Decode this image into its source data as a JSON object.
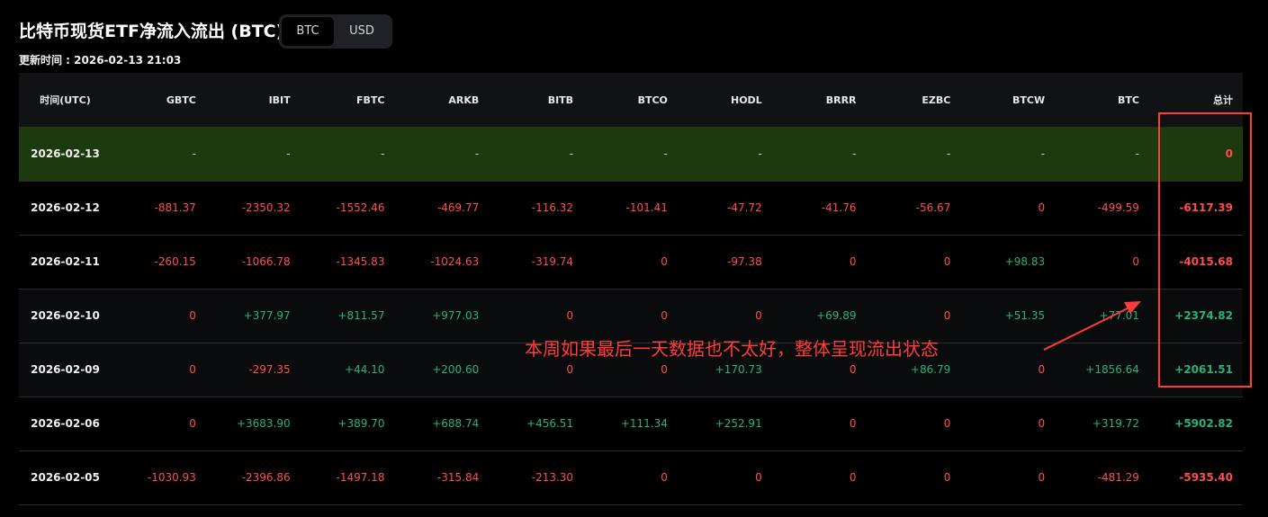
{
  "header": {
    "title": "比特币现货ETF净流入流出 (BTC)",
    "updated": "更新时间 : 2026-02-13 21:03"
  },
  "toggle": {
    "options": [
      "BTC",
      "USD"
    ],
    "selected": "BTC"
  },
  "table": {
    "columns": [
      "时间(UTC)",
      "GBTC",
      "IBIT",
      "FBTC",
      "ARKB",
      "BITB",
      "BTCO",
      "HODL",
      "BRRR",
      "EZBC",
      "BTCW",
      "BTC",
      "总计"
    ],
    "rows": [
      [
        "2026-02-13",
        "-",
        "-",
        "-",
        "-",
        "-",
        "-",
        "-",
        "-",
        "-",
        "-",
        "-",
        "0"
      ],
      [
        "2026-02-12",
        "-881.37",
        "-2350.32",
        "-1552.46",
        "-469.77",
        "-116.32",
        "-101.41",
        "-47.72",
        "-41.76",
        "-56.67",
        "0",
        "-499.59",
        "-6117.39"
      ],
      [
        "2026-02-11",
        "-260.15",
        "-1066.78",
        "-1345.83",
        "-1024.63",
        "-319.74",
        "0",
        "-97.38",
        "0",
        "0",
        "+98.83",
        "0",
        "-4015.68"
      ],
      [
        "2026-02-10",
        "0",
        "+377.97",
        "+811.57",
        "+977.03",
        "0",
        "0",
        "0",
        "+69.89",
        "0",
        "+51.35",
        "+77.01",
        "+2374.82"
      ],
      [
        "2026-02-09",
        "0",
        "-297.35",
        "+44.10",
        "+200.60",
        "0",
        "0",
        "+170.73",
        "0",
        "+86.79",
        "0",
        "+1856.64",
        "+2061.51"
      ],
      [
        "2026-02-06",
        "0",
        "+3683.90",
        "+389.70",
        "+688.74",
        "+456.51",
        "+111.34",
        "+252.91",
        "0",
        "0",
        "0",
        "+319.72",
        "+5902.82"
      ],
      [
        "2026-02-05",
        "-1030.93",
        "-2396.86",
        "-1497.18",
        "-315.84",
        "-213.30",
        "0",
        "0",
        "0",
        "0",
        "0",
        "-481.29",
        "-5935.40"
      ]
    ]
  },
  "annotation": {
    "text": "本周如果最后一天数据也不太好，整体呈现流出状态",
    "color": "#ff3b3b"
  },
  "colors": {
    "negative": "#ff4d4f",
    "positive": "#26b37a",
    "highlight_row": "#1d3a0f",
    "background": "#000000"
  }
}
